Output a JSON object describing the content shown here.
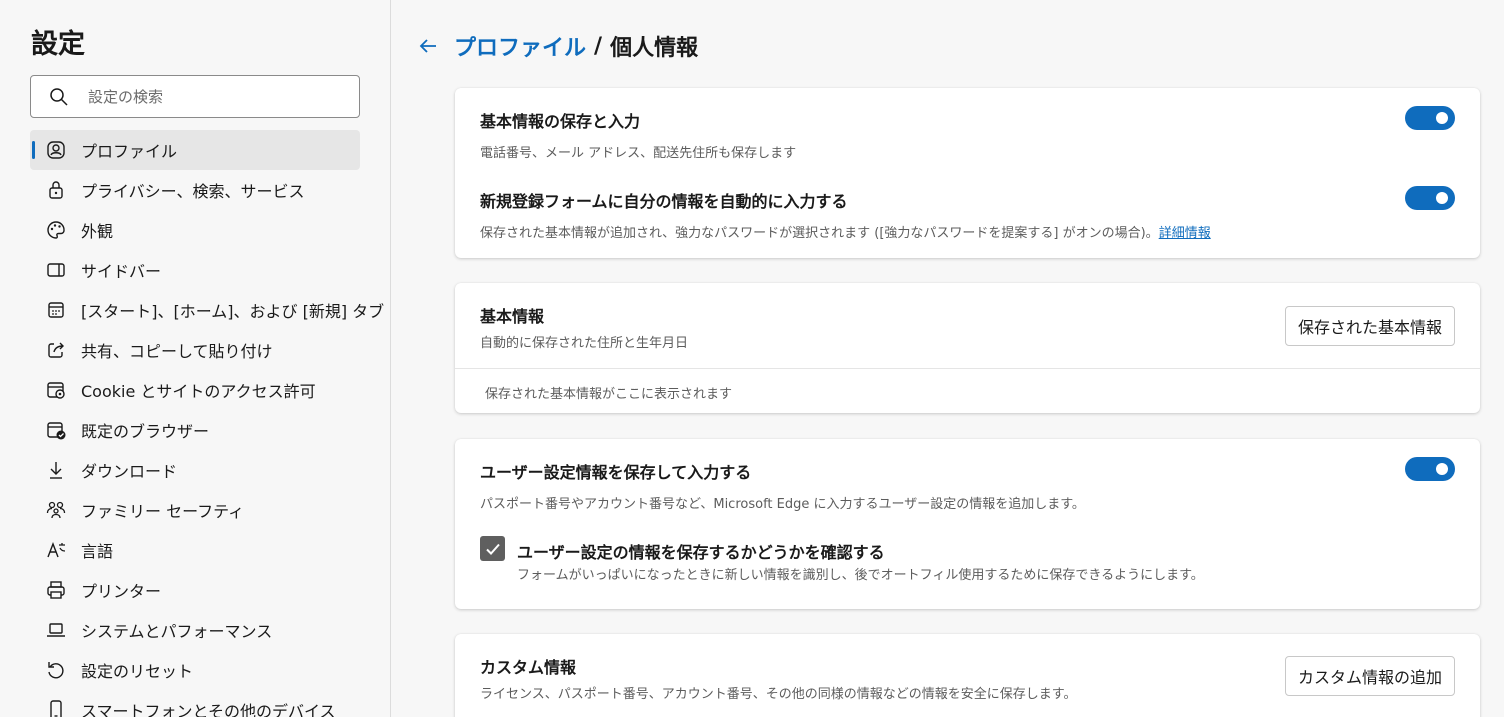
{
  "sidebar": {
    "title": "設定",
    "search": {
      "placeholder": "設定の検索"
    },
    "items": [
      {
        "label": "プロファイル",
        "icon": "profile-icon",
        "active": true
      },
      {
        "label": "プライバシー、検索、サービス",
        "icon": "lock-icon"
      },
      {
        "label": "外観",
        "icon": "palette-icon"
      },
      {
        "label": "サイドバー",
        "icon": "sidebar-icon"
      },
      {
        "label": "[スタート]、[ホーム]、および [新規] タブ",
        "icon": "new-tab-icon"
      },
      {
        "label": "共有、コピーして貼り付け",
        "icon": "share-icon"
      },
      {
        "label": "Cookie とサイトのアクセス許可",
        "icon": "site-permissions-icon"
      },
      {
        "label": "既定のブラウザー",
        "icon": "default-browser-icon"
      },
      {
        "label": "ダウンロード",
        "icon": "download-icon"
      },
      {
        "label": "ファミリー セーフティ",
        "icon": "family-icon"
      },
      {
        "label": "言語",
        "icon": "language-icon"
      },
      {
        "label": "プリンター",
        "icon": "printer-icon"
      },
      {
        "label": "システムとパフォーマンス",
        "icon": "laptop-icon"
      },
      {
        "label": "設定のリセット",
        "icon": "reset-icon"
      },
      {
        "label": "スマートフォンとその他のデバイス",
        "icon": "phone-icon"
      }
    ]
  },
  "header": {
    "back_icon": "back-arrow-icon",
    "parent": "プロファイル",
    "separator": "/",
    "current": "個人情報"
  },
  "card_autofill": {
    "save_title": "基本情報の保存と入力",
    "save_desc": "電話番号、メール アドレス、配送先住所も保存します",
    "save_toggle_on": true,
    "signup_title": "新規登録フォームに自分の情報を自動的に入力する",
    "signup_desc": "保存された基本情報が追加され、強力なパスワードが選択されます ([強力なパスワードを提案する] がオンの場合)。",
    "signup_link": "詳細情報",
    "signup_toggle_on": true
  },
  "card_basic": {
    "title": "基本情報",
    "desc": "自動的に保存された住所と生年月日",
    "button": "保存された基本情報",
    "empty": "保存された基本情報がここに表示されます"
  },
  "card_custom_settings": {
    "title": "ユーザー設定情報を保存して入力する",
    "desc": "パスポート番号やアカウント番号など、Microsoft Edge に入力するユーザー設定の情報を追加します。",
    "toggle_on": true,
    "checkbox_title": "ユーザー設定の情報を保存するかどうかを確認する",
    "checkbox_desc": "フォームがいっぱいになったときに新しい情報を識別し、後でオートフィル使用するために保存できるようにします。",
    "checked": true
  },
  "card_custom_info": {
    "title": "カスタム情報",
    "desc": "ライセンス、パスポート番号、アカウント番号、その他の同様の情報などの情報を安全に保存します。",
    "button": "カスタム情報の追加"
  },
  "colors": {
    "accent": "#0f6cbd",
    "background": "#f7f7f7",
    "card": "#ffffff"
  }
}
